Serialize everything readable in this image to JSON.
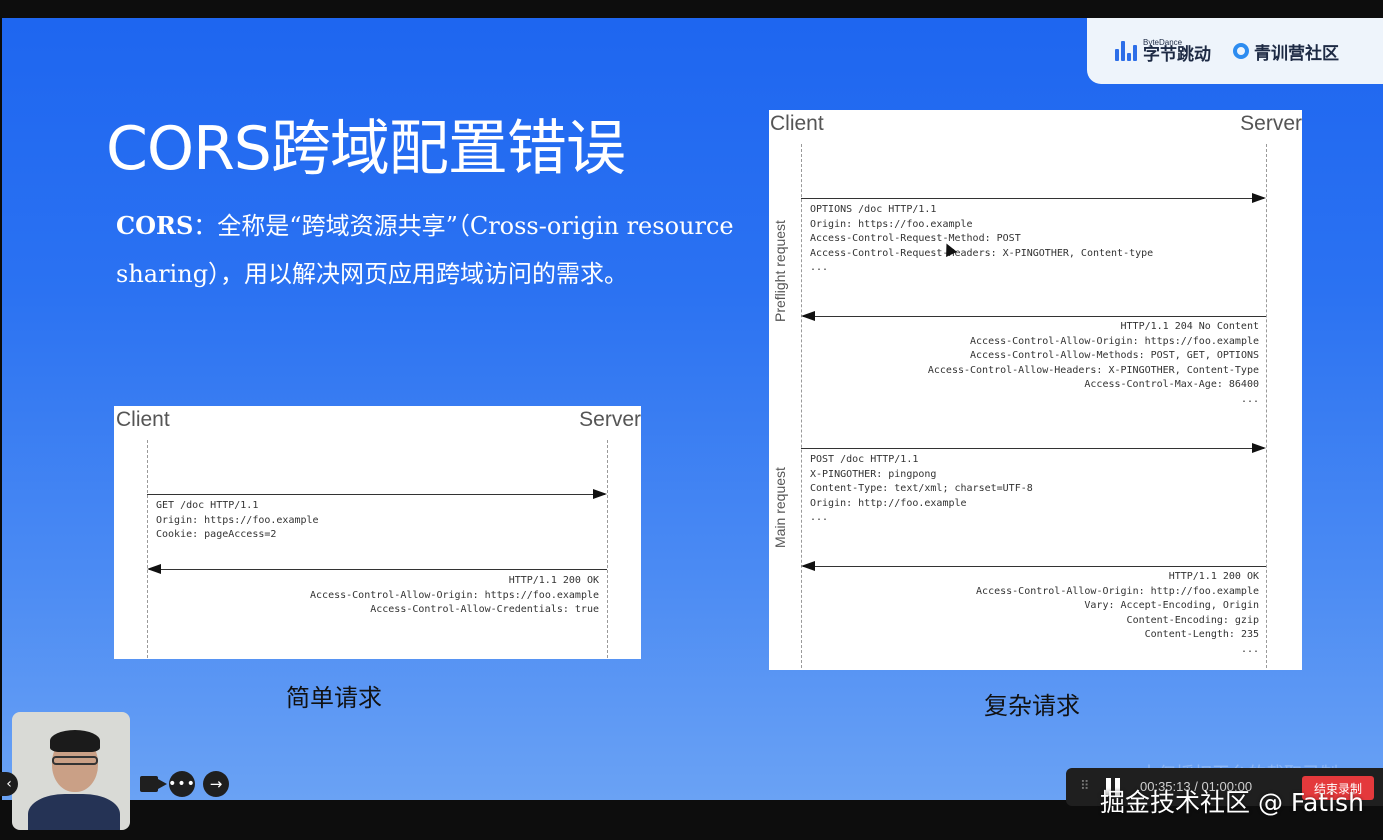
{
  "brand": {
    "bytedance_small": "ByteDance",
    "bytedance_name": "字节跳动",
    "community_name": "青训营社区"
  },
  "slide": {
    "title": "CORS跨域配置错误",
    "desc_bold": "CORS",
    "desc_rest": "：全称是“跨域资源共享”（Cross-origin resource sharing），用以解决网页应用跨域访问的需求。"
  },
  "simple_diagram": {
    "client_label": "Client",
    "server_label": "Server",
    "request_lines": "GET /doc HTTP/1.1\nOrigin: https://foo.example\nCookie: pageAccess=2",
    "response_lines": "HTTP/1.1 200 OK\nAccess-Control-Allow-Origin: https://foo.example\nAccess-Control-Allow-Credentials: true",
    "caption": "简单请求"
  },
  "complex_diagram": {
    "client_label": "Client",
    "server_label": "Server",
    "preflight_label": "Preflight request",
    "main_label": "Main request",
    "preflight_request": "OPTIONS /doc HTTP/1.1\nOrigin: https://foo.example\nAccess-Control-Request-Method: POST\nAccess-Control-Request-Headers: X-PINGOTHER, Content-type\n...",
    "preflight_response": "HTTP/1.1 204 No Content\nAccess-Control-Allow-Origin: https://foo.example\nAccess-Control-Allow-Methods: POST, GET, OPTIONS\nAccess-Control-Allow-Headers: X-PINGOTHER, Content-Type\nAccess-Control-Max-Age: 86400\n...",
    "main_request": "POST /doc HTTP/1.1\nX-PINGOTHER: pingpong\nContent-Type: text/xml; charset=UTF-8\nOrigin: http://foo.example\n...",
    "main_response": "HTTP/1.1 200 OK\nAccess-Control-Allow-Origin: http://foo.example\nVary: Accept-Encoding, Origin\nContent-Encoding: gzip\nContent-Length: 235\n...",
    "caption": "复杂请求"
  },
  "overlay": {
    "watermark": "本仅授权平台的截取录制",
    "rec_time": "00:35:13 / 01:00:00",
    "rec_stop_label": "结束录制",
    "juejin_watermark": "掘金技术社区 @ Fatish",
    "more_glyph": "•••",
    "next_glyph": "→",
    "collapse_glyph": "‹",
    "grip_glyph": "⠿"
  }
}
